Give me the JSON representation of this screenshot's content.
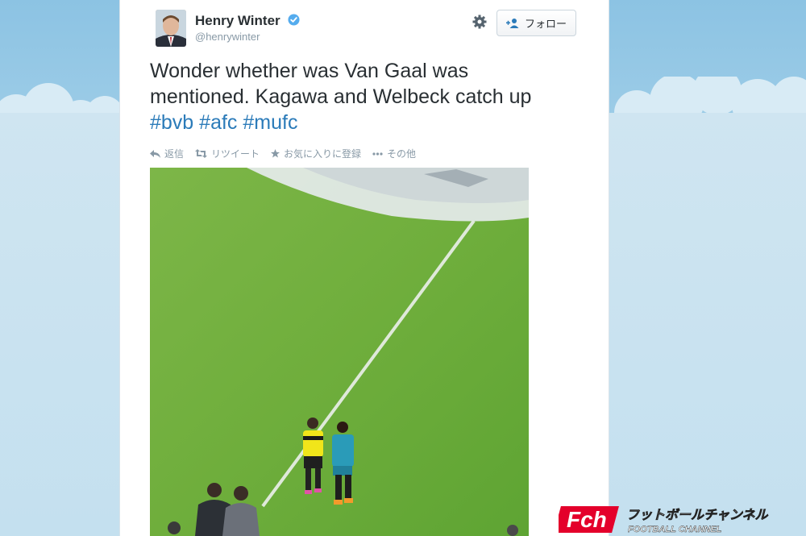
{
  "tweet": {
    "author_name": "Henry Winter",
    "author_handle": "@henrywinter",
    "follow_label": "フォロー",
    "text_parts": {
      "line1": "Wonder whether was Van Gaal was",
      "line2": "mentioned. Kagawa and Welbeck catch up",
      "tags": [
        "#bvb",
        "#afc",
        "#mufc"
      ]
    },
    "actions": {
      "reply": "返信",
      "retweet": "リツイート",
      "favorite": "お気に入りに登録",
      "more": "その他"
    }
  },
  "watermark": {
    "logo_text": "Fch",
    "jp_text": "フットボールチャンネル",
    "en_text": "FOOTBALL CHANNEL"
  },
  "colors": {
    "link": "#2b7bb9",
    "text": "#292f33",
    "muted": "#8899a6",
    "verified": "#55acee",
    "logo_red": "#e4002b"
  }
}
